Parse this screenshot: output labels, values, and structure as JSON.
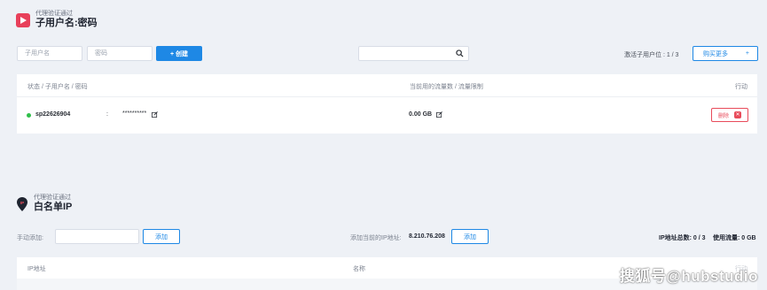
{
  "subusers": {
    "subtitle": "代理验证通过",
    "title": "子用户名:密码",
    "username_placeholder": "子用户名",
    "password_placeholder": "密码",
    "create_label": "+ 创建",
    "active_label": "激活子用户位 :  1 / 3",
    "buy_more_label": "购买更多",
    "buy_more_plus": "+",
    "columns": {
      "status": "状态 / 子用户名 / 密码",
      "traffic": "当前用的流量数 / 流量限制",
      "action": "行动"
    },
    "rows": [
      {
        "username": "sp22626904",
        "separator": ":",
        "password": "**********",
        "traffic": "0.00 GB",
        "delete_label": "删除",
        "delete_x": "✕"
      }
    ]
  },
  "whitelist": {
    "subtitle": "代理验证通过",
    "title": "白名单IP",
    "manual_label": "手动添加:",
    "add_label": "添加",
    "current_ip_label": "添加当前的IP地址:",
    "current_ip": "8.210.76.208",
    "add_current_label": "添加",
    "ip_total_label": "IP地址总数: 0 / 3",
    "traffic_used_label": "使用流量: 0 GB",
    "columns": {
      "ip": "IP地址",
      "name": "名称",
      "action": "行动"
    }
  },
  "watermark": "搜狐号@hubstudio",
  "colors": {
    "accent": "#1e88e5",
    "danger": "#e84b5a",
    "status_active": "#2fbf4a",
    "brand": "#e8405a"
  },
  "icons": {
    "logo": "brand-logo-icon",
    "pin": "location-pin-icon",
    "search": "search-icon",
    "edit": "edit-icon",
    "delete": "close-icon"
  }
}
